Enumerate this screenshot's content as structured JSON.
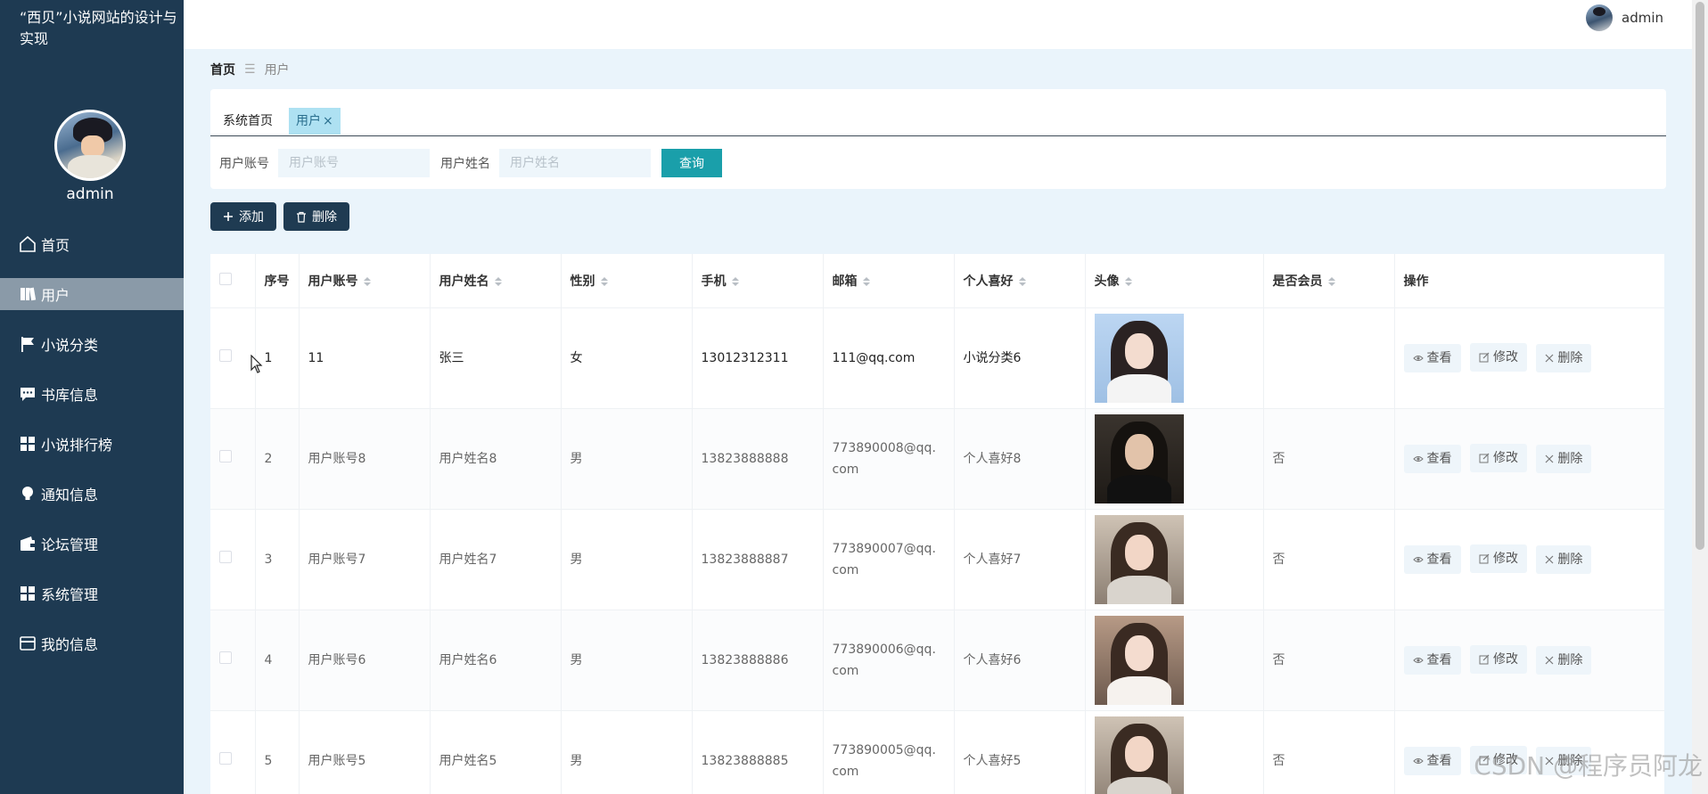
{
  "sidebar": {
    "site_title": "“西贝”小说网站的设计与实现",
    "user_name": "admin",
    "items": [
      {
        "label": "首页",
        "icon": "home-icon",
        "active": false
      },
      {
        "label": "用户",
        "icon": "book-icon",
        "active": true
      },
      {
        "label": "小说分类",
        "icon": "flag-icon",
        "active": false
      },
      {
        "label": "书库信息",
        "icon": "chat-icon",
        "active": false
      },
      {
        "label": "小说排行榜",
        "icon": "grid-icon",
        "active": false
      },
      {
        "label": "通知信息",
        "icon": "bulb-icon",
        "active": false
      },
      {
        "label": "论坛管理",
        "icon": "wallet-icon",
        "active": false
      },
      {
        "label": "系统管理",
        "icon": "grid-icon",
        "active": false
      },
      {
        "label": "我的信息",
        "icon": "card-icon",
        "active": false
      }
    ]
  },
  "header": {
    "user_name": "admin"
  },
  "breadcrumb": {
    "home": "首页",
    "current": "用户"
  },
  "tabs": [
    {
      "label": "系统首页"
    },
    {
      "label": "用户",
      "close": "×"
    }
  ],
  "filters": {
    "account_label": "用户账号",
    "account_placeholder": "用户账号",
    "name_label": "用户姓名",
    "name_placeholder": "用户姓名",
    "search_label": "查询"
  },
  "actions": {
    "add_label": "添加",
    "delete_label": "删除"
  },
  "table": {
    "headers": [
      "序号",
      "用户账号",
      "用户姓名",
      "性别",
      "手机",
      "邮箱",
      "个人喜好",
      "头像",
      "是否会员",
      "操作"
    ],
    "op_labels": {
      "view": "查看",
      "edit": "修改",
      "delete": "删除"
    },
    "rows": [
      {
        "no": "1",
        "account": "11",
        "name": "张三",
        "gender": "女",
        "phone": "13012312311",
        "email": "111@qq.com",
        "hobby": "小说分类6",
        "member": ""
      },
      {
        "no": "2",
        "account": "用户账号8",
        "name": "用户姓名8",
        "gender": "男",
        "phone": "13823888888",
        "email": "773890008@qq.com",
        "hobby": "个人喜好8",
        "member": "否"
      },
      {
        "no": "3",
        "account": "用户账号7",
        "name": "用户姓名7",
        "gender": "男",
        "phone": "13823888887",
        "email": "773890007@qq.com",
        "hobby": "个人喜好7",
        "member": "否"
      },
      {
        "no": "4",
        "account": "用户账号6",
        "name": "用户姓名6",
        "gender": "男",
        "phone": "13823888886",
        "email": "773890006@qq.com",
        "hobby": "个人喜好6",
        "member": "否"
      },
      {
        "no": "5",
        "account": "用户账号5",
        "name": "用户姓名5",
        "gender": "男",
        "phone": "13823888885",
        "email": "773890005@qq.com",
        "hobby": "个人喜好5",
        "member": "否"
      }
    ]
  },
  "watermark": "CSDN @程序员阿龙",
  "colors": {
    "sidebar": "#1e3a52",
    "accent": "#1a9faa",
    "active_tab": "#aee1f2",
    "page_bg": "#eaf4fb"
  }
}
